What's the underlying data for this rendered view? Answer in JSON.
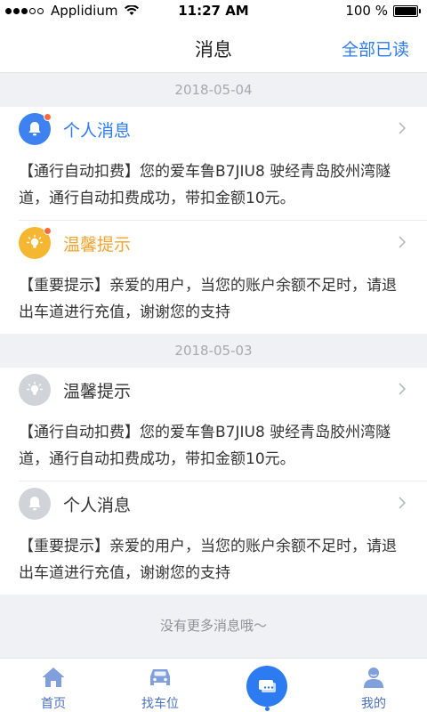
{
  "status_bar": {
    "carrier": "Applidium",
    "time": "11:27 AM",
    "battery": "100 %"
  },
  "nav": {
    "title": "消息",
    "action": "全部已读"
  },
  "sections": [
    {
      "date": "2018-05-04",
      "messages": [
        {
          "title": "个人消息",
          "icon": "bell-icon",
          "unread": true,
          "body": "【通行自动扣费】您的爱车鲁B7JIU8 驶经青岛胶州湾隧道，通行自动扣费成功，带扣金额10元。"
        },
        {
          "title": "温馨提示",
          "icon": "lightbulb-icon",
          "unread": true,
          "body": "【重要提示】亲爱的用户，当您的账户余额不足时，请退出车道进行充值，谢谢您的支持"
        }
      ]
    },
    {
      "date": "2018-05-03",
      "messages": [
        {
          "title": "温馨提示",
          "icon": "lightbulb-icon",
          "unread": false,
          "body": "【通行自动扣费】您的爱车鲁B7JIU8 驶经青岛胶州湾隧道，通行自动扣费成功，带扣金额10元。"
        },
        {
          "title": "个人消息",
          "icon": "bell-icon",
          "unread": false,
          "body": "【重要提示】亲爱的用户，当您的账户余额不足时，请退出车道进行充值，谢谢您的支持"
        }
      ]
    }
  ],
  "footer_note": "没有更多消息哦～",
  "tabs": [
    {
      "label": "首页",
      "icon": "home-icon"
    },
    {
      "label": "找车位",
      "icon": "car-icon"
    },
    {
      "label": "",
      "icon": "message-icon"
    },
    {
      "label": "我的",
      "icon": "user-icon"
    }
  ],
  "colors": {
    "accent": "#2d7bf0",
    "bell_active": "#3d82f0",
    "bulb_active": "#f5b731",
    "title_active_bell": "#2d7bf0",
    "title_active_bulb": "#f1a531",
    "inactive_icon": "#d0d3d8",
    "badge": "#ff6a3c"
  }
}
